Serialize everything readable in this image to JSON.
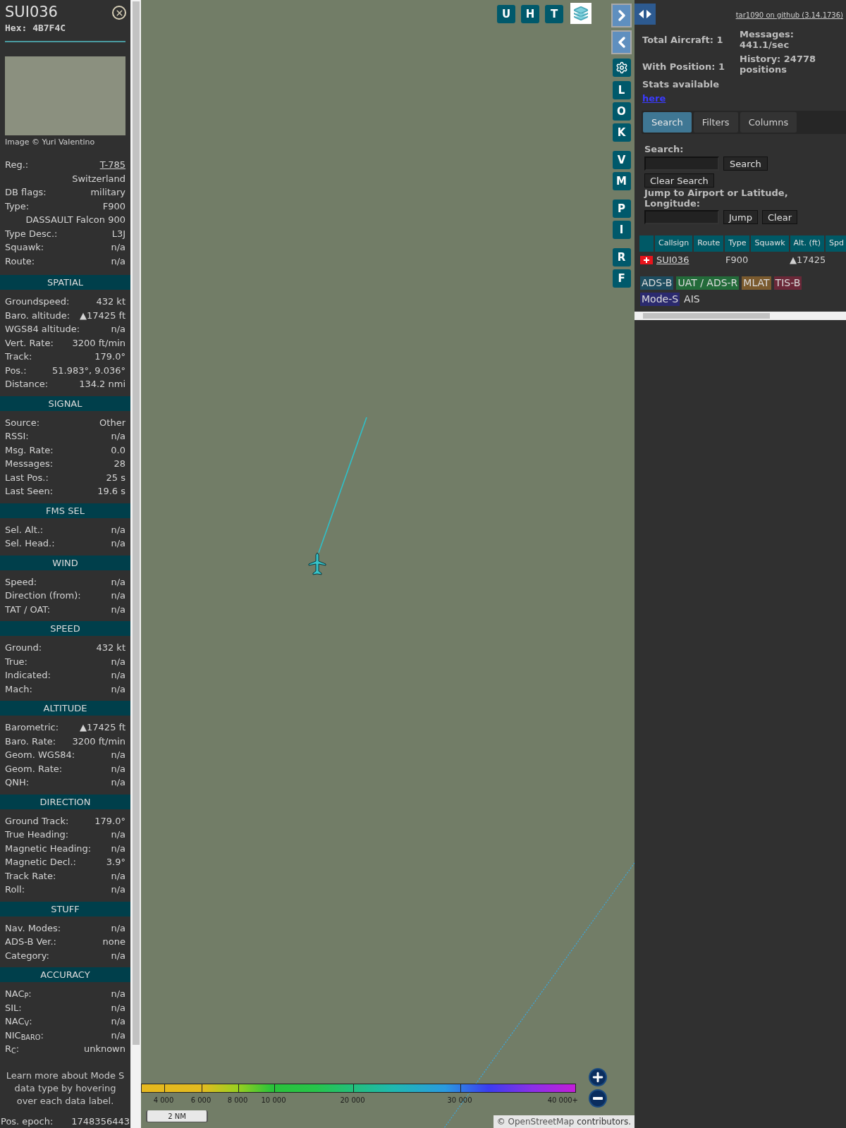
{
  "aircraft": {
    "callsign": "SUI036",
    "hex": "Hex: 4B7F4C",
    "photo_credit": "Image © Yuri Valentino"
  },
  "info_rows": [
    {
      "label": "Reg.:",
      "value": "T-785",
      "kind": "link"
    },
    {
      "value": "Switzerland",
      "kind": "text"
    },
    {
      "label": "DB flags:",
      "value": "military",
      "kind": "text"
    },
    {
      "label": "Type:",
      "value": "F900",
      "kind": "text"
    },
    {
      "value": "DASSAULT Falcon 900",
      "kind": "text"
    },
    {
      "label": "Type Desc.:",
      "value": "L3J",
      "kind": "text"
    },
    {
      "label": "Squawk:",
      "value": "n/a",
      "kind": "text"
    },
    {
      "label": "Route:",
      "value": "n/a",
      "kind": "text"
    }
  ],
  "sections": [
    {
      "title": "SPATIAL",
      "rows": [
        {
          "label": "Groundspeed:",
          "value": "432 kt"
        },
        {
          "label": "Baro. altitude:",
          "value": "▲17425 ft"
        },
        {
          "label": "WGS84 altitude:",
          "value": "n/a"
        },
        {
          "label": "Vert. Rate:",
          "value": "3200 ft/min"
        },
        {
          "label": "Track:",
          "value": "179.0°"
        },
        {
          "label": "Pos.:",
          "value": "51.983°, 9.036°"
        },
        {
          "label": "Distance:",
          "value": "134.2 nmi"
        }
      ]
    },
    {
      "title": "SIGNAL",
      "rows": [
        {
          "label": "Source:",
          "value": "Other"
        },
        {
          "label": "RSSI:",
          "value": "n/a"
        },
        {
          "label": "Msg. Rate:",
          "value": "0.0"
        },
        {
          "label": "Messages:",
          "value": "28"
        },
        {
          "label": "Last Pos.:",
          "value": "25 s"
        },
        {
          "label": "Last Seen:",
          "value": "19.6 s"
        }
      ]
    },
    {
      "title": "FMS SEL",
      "rows": [
        {
          "label": "Sel. Alt.:",
          "value": "n/a"
        },
        {
          "label": "Sel. Head.:",
          "value": "n/a"
        }
      ]
    },
    {
      "title": "WIND",
      "rows": [
        {
          "label": "Speed:",
          "value": "n/a"
        },
        {
          "label": "Direction (from):",
          "value": "n/a"
        },
        {
          "label": "TAT / OAT:",
          "value": "n/a"
        }
      ]
    },
    {
      "title": "SPEED",
      "rows": [
        {
          "label": "Ground:",
          "value": "432 kt"
        },
        {
          "label": "True:",
          "value": "n/a"
        },
        {
          "label": "Indicated:",
          "value": "n/a"
        },
        {
          "label": "Mach:",
          "value": "n/a"
        }
      ]
    },
    {
      "title": "ALTITUDE",
      "rows": [
        {
          "label": "Barometric:",
          "value": "▲17425 ft"
        },
        {
          "label": "Baro. Rate:",
          "value": "3200 ft/min"
        },
        {
          "label": "Geom. WGS84:",
          "value": "n/a"
        },
        {
          "label": "Geom. Rate:",
          "value": "n/a"
        },
        {
          "label": "QNH:",
          "value": "n/a"
        }
      ]
    },
    {
      "title": "DIRECTION",
      "rows": [
        {
          "label": "Ground Track:",
          "value": "179.0°"
        },
        {
          "label": "True Heading:",
          "value": "n/a"
        },
        {
          "label": "Magnetic Heading:",
          "value": "n/a"
        },
        {
          "label": "Magnetic Decl.:",
          "value": "3.9°"
        },
        {
          "label": "Track Rate:",
          "value": "n/a"
        },
        {
          "label": "Roll:",
          "value": "n/a"
        }
      ]
    },
    {
      "title": "STUFF",
      "rows": [
        {
          "label": "Nav. Modes:",
          "value": "n/a"
        },
        {
          "label": "ADS-B Ver.:",
          "value": "none"
        },
        {
          "label": "Category:",
          "value": "n/a"
        }
      ]
    },
    {
      "title": "ACCURACY",
      "rows": [
        {
          "label": "NAC$_{P}$:",
          "value": "n/a"
        },
        {
          "label": "SIL:",
          "value": "n/a"
        },
        {
          "label": "NAC$_{V}$:",
          "value": "n/a"
        },
        {
          "label": "NIC$_{BARO}$:",
          "value": "n/a"
        },
        {
          "label": "R$_{C}$:",
          "value": "unknown"
        }
      ]
    }
  ],
  "footer_note": "Learn more about Mode S data type by hovering over each data label.",
  "pos_epoch": {
    "label": "Pos. epoch:",
    "value": "1748356443"
  },
  "map": {
    "top_buttons": [
      "U",
      "H",
      "T"
    ],
    "side_buttons": [
      "L",
      "O",
      "K",
      "V",
      "M",
      "P",
      "I",
      "R",
      "F"
    ],
    "altitude_legend": [
      "4 000",
      "6 000",
      "8 000",
      "10 000",
      "20 000",
      "30 000",
      "40 000+"
    ],
    "scale": "2 NM",
    "attribution": {
      "prefix": "©",
      "link": "OpenStreetMap",
      "suffix": "contributors."
    }
  },
  "sidebar": {
    "version_link": "tar1090 on github (3.14.1736)",
    "stats_left": [
      "Total Aircraft: 1",
      "With Position: 1"
    ],
    "stats_right": [
      "Messages: 441.1/sec",
      "History: 24778 positions"
    ],
    "stats_label": "Stats available",
    "stats_link": "here",
    "tabs": [
      {
        "label": "Search",
        "selected": true
      },
      {
        "label": "Filters",
        "selected": false
      },
      {
        "label": "Columns",
        "selected": false
      }
    ],
    "search_label": "Search:",
    "search_button": "Search",
    "clear_search_button": "Clear Search",
    "jump_label": "Jump to Airport or Latitude, Longitude:",
    "jump_button": "Jump",
    "clear_button": "Clear",
    "table": {
      "columns": [
        "Callsign",
        "Route",
        "Type",
        "Squawk",
        "Alt. (ft)",
        "Spd"
      ],
      "rows": [
        {
          "cells": [
            "SUI036",
            null,
            "F900",
            null,
            "▲17425",
            null
          ]
        }
      ]
    },
    "sources": [
      {
        "label": "ADS-B",
        "color": "#1d4c5f"
      },
      {
        "label": "UAT / ADS-R",
        "color": "#236b3a"
      },
      {
        "label": "MLAT",
        "color": "#7a5a2e"
      },
      {
        "label": "TIS-B",
        "color": "#6a2838"
      },
      {
        "label": "Mode-S",
        "color": "#2b2a6e"
      },
      {
        "label": "AIS",
        "color": "#303030"
      }
    ]
  }
}
